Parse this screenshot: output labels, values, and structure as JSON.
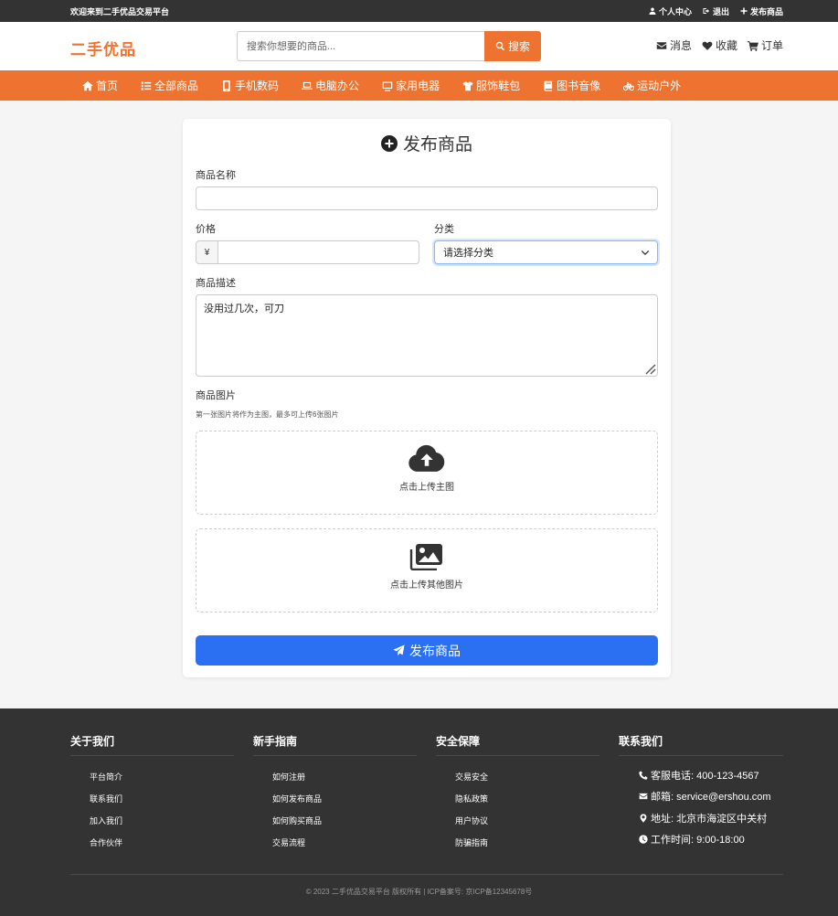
{
  "topbar": {
    "welcome": "欢迎来到二手优品交易平台",
    "links": [
      {
        "label": "个人中心",
        "icon": "user-icon"
      },
      {
        "label": "退出",
        "icon": "logout-icon"
      },
      {
        "label": "发布商品",
        "icon": "plus-icon"
      }
    ]
  },
  "header": {
    "logo": "二手优品",
    "search_placeholder": "搜索你想要的商品...",
    "search_button": "搜索",
    "links": [
      {
        "label": "消息",
        "icon": "envelope-icon"
      },
      {
        "label": "收藏",
        "icon": "heart-icon"
      },
      {
        "label": "订单",
        "icon": "cart-icon"
      }
    ]
  },
  "nav": {
    "items": [
      {
        "label": "首页",
        "icon": "home-icon"
      },
      {
        "label": "全部商品",
        "icon": "list-icon"
      },
      {
        "label": "手机数码",
        "icon": "mobile-icon"
      },
      {
        "label": "电脑办公",
        "icon": "laptop-icon"
      },
      {
        "label": "家用电器",
        "icon": "tv-icon"
      },
      {
        "label": "服饰鞋包",
        "icon": "shirt-icon"
      },
      {
        "label": "图书音像",
        "icon": "book-icon"
      },
      {
        "label": "运动户外",
        "icon": "bicycle-icon"
      }
    ]
  },
  "form": {
    "title": "发布商品",
    "name_label": "商品名称",
    "name_value": "",
    "price_label": "价格",
    "price_prefix": "¥",
    "price_value": "",
    "category_label": "分类",
    "category_selected": "请选择分类",
    "desc_label": "商品描述",
    "desc_value": "没用过几次，可刀",
    "images_label": "商品图片",
    "images_hint": "第一张图片将作为主图，最多可上传6张图片",
    "upload_main": "点击上传主图",
    "upload_other": "点击上传其他图片",
    "submit": "发布商品",
    "accent": "#2b6ff2"
  },
  "footer": {
    "columns": [
      {
        "title": "关于我们",
        "items": [
          "平台简介",
          "联系我们",
          "加入我们",
          "合作伙伴"
        ]
      },
      {
        "title": "新手指南",
        "items": [
          "如何注册",
          "如何发布商品",
          "如何购买商品",
          "交易流程"
        ]
      },
      {
        "title": "安全保障",
        "items": [
          "交易安全",
          "隐私政策",
          "用户协议",
          "防骗指南"
        ]
      }
    ],
    "contact_title": "联系我们",
    "contact": [
      {
        "text": "客服电话: 400-123-4567",
        "icon": "phone-icon"
      },
      {
        "text": "邮箱: service@ershou.com",
        "icon": "envelope-icon"
      },
      {
        "text": "地址: 北京市海淀区中关村",
        "icon": "location-icon"
      },
      {
        "text": "工作时间: 9:00-18:00",
        "icon": "clock-icon"
      }
    ],
    "copyright": "© 2023 二手优品交易平台 版权所有 | ICP备案号: 京ICP备12345678号"
  },
  "colors": {
    "brand": "#ef7330",
    "topbar": "#333333",
    "footer": "#333333"
  }
}
